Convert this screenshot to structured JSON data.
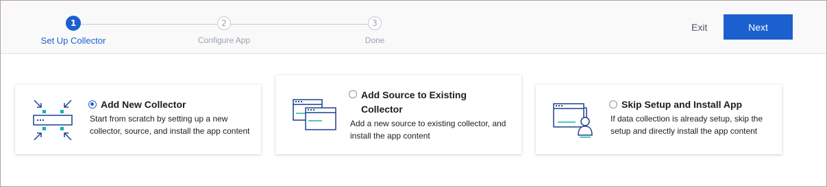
{
  "wizard": {
    "steps": [
      {
        "number": "1",
        "label": "Set Up Collector",
        "state": "active"
      },
      {
        "number": "2",
        "label": "Configure App",
        "state": "inactive"
      },
      {
        "number": "3",
        "label": "Done",
        "state": "inactive"
      }
    ],
    "exit_label": "Exit",
    "next_label": "Next"
  },
  "options": [
    {
      "title": "Add New Collector",
      "description": "Start from scratch by setting up a new collector, source, and install the app content",
      "selected": true,
      "icon": "new-collector-icon"
    },
    {
      "title": "Add Source to Existing Collector",
      "description": "Add a new source to existing collector, and install the app content",
      "selected": false,
      "icon": "add-source-icon"
    },
    {
      "title": "Skip Setup and Install App",
      "description": "If data collection is already setup, skip the setup and directly install the app content",
      "selected": false,
      "icon": "skip-setup-icon"
    }
  ],
  "colors": {
    "accent": "#1c5fce",
    "icon_navy": "#1b3e8e",
    "icon_teal": "#16b3b0"
  }
}
